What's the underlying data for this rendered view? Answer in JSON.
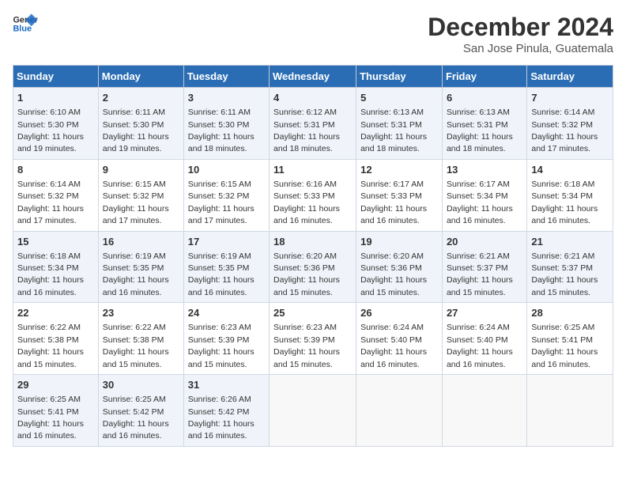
{
  "logo": {
    "line1": "General",
    "line2": "Blue"
  },
  "title": "December 2024",
  "subtitle": "San Jose Pinula, Guatemala",
  "weekdays": [
    "Sunday",
    "Monday",
    "Tuesday",
    "Wednesday",
    "Thursday",
    "Friday",
    "Saturday"
  ],
  "weeks": [
    [
      {
        "day": "1",
        "sunrise": "Sunrise: 6:10 AM",
        "sunset": "Sunset: 5:30 PM",
        "daylight": "Daylight: 11 hours and 19 minutes."
      },
      {
        "day": "2",
        "sunrise": "Sunrise: 6:11 AM",
        "sunset": "Sunset: 5:30 PM",
        "daylight": "Daylight: 11 hours and 19 minutes."
      },
      {
        "day": "3",
        "sunrise": "Sunrise: 6:11 AM",
        "sunset": "Sunset: 5:30 PM",
        "daylight": "Daylight: 11 hours and 18 minutes."
      },
      {
        "day": "4",
        "sunrise": "Sunrise: 6:12 AM",
        "sunset": "Sunset: 5:31 PM",
        "daylight": "Daylight: 11 hours and 18 minutes."
      },
      {
        "day": "5",
        "sunrise": "Sunrise: 6:13 AM",
        "sunset": "Sunset: 5:31 PM",
        "daylight": "Daylight: 11 hours and 18 minutes."
      },
      {
        "day": "6",
        "sunrise": "Sunrise: 6:13 AM",
        "sunset": "Sunset: 5:31 PM",
        "daylight": "Daylight: 11 hours and 18 minutes."
      },
      {
        "day": "7",
        "sunrise": "Sunrise: 6:14 AM",
        "sunset": "Sunset: 5:32 PM",
        "daylight": "Daylight: 11 hours and 17 minutes."
      }
    ],
    [
      {
        "day": "8",
        "sunrise": "Sunrise: 6:14 AM",
        "sunset": "Sunset: 5:32 PM",
        "daylight": "Daylight: 11 hours and 17 minutes."
      },
      {
        "day": "9",
        "sunrise": "Sunrise: 6:15 AM",
        "sunset": "Sunset: 5:32 PM",
        "daylight": "Daylight: 11 hours and 17 minutes."
      },
      {
        "day": "10",
        "sunrise": "Sunrise: 6:15 AM",
        "sunset": "Sunset: 5:32 PM",
        "daylight": "Daylight: 11 hours and 17 minutes."
      },
      {
        "day": "11",
        "sunrise": "Sunrise: 6:16 AM",
        "sunset": "Sunset: 5:33 PM",
        "daylight": "Daylight: 11 hours and 16 minutes."
      },
      {
        "day": "12",
        "sunrise": "Sunrise: 6:17 AM",
        "sunset": "Sunset: 5:33 PM",
        "daylight": "Daylight: 11 hours and 16 minutes."
      },
      {
        "day": "13",
        "sunrise": "Sunrise: 6:17 AM",
        "sunset": "Sunset: 5:34 PM",
        "daylight": "Daylight: 11 hours and 16 minutes."
      },
      {
        "day": "14",
        "sunrise": "Sunrise: 6:18 AM",
        "sunset": "Sunset: 5:34 PM",
        "daylight": "Daylight: 11 hours and 16 minutes."
      }
    ],
    [
      {
        "day": "15",
        "sunrise": "Sunrise: 6:18 AM",
        "sunset": "Sunset: 5:34 PM",
        "daylight": "Daylight: 11 hours and 16 minutes."
      },
      {
        "day": "16",
        "sunrise": "Sunrise: 6:19 AM",
        "sunset": "Sunset: 5:35 PM",
        "daylight": "Daylight: 11 hours and 16 minutes."
      },
      {
        "day": "17",
        "sunrise": "Sunrise: 6:19 AM",
        "sunset": "Sunset: 5:35 PM",
        "daylight": "Daylight: 11 hours and 16 minutes."
      },
      {
        "day": "18",
        "sunrise": "Sunrise: 6:20 AM",
        "sunset": "Sunset: 5:36 PM",
        "daylight": "Daylight: 11 hours and 15 minutes."
      },
      {
        "day": "19",
        "sunrise": "Sunrise: 6:20 AM",
        "sunset": "Sunset: 5:36 PM",
        "daylight": "Daylight: 11 hours and 15 minutes."
      },
      {
        "day": "20",
        "sunrise": "Sunrise: 6:21 AM",
        "sunset": "Sunset: 5:37 PM",
        "daylight": "Daylight: 11 hours and 15 minutes."
      },
      {
        "day": "21",
        "sunrise": "Sunrise: 6:21 AM",
        "sunset": "Sunset: 5:37 PM",
        "daylight": "Daylight: 11 hours and 15 minutes."
      }
    ],
    [
      {
        "day": "22",
        "sunrise": "Sunrise: 6:22 AM",
        "sunset": "Sunset: 5:38 PM",
        "daylight": "Daylight: 11 hours and 15 minutes."
      },
      {
        "day": "23",
        "sunrise": "Sunrise: 6:22 AM",
        "sunset": "Sunset: 5:38 PM",
        "daylight": "Daylight: 11 hours and 15 minutes."
      },
      {
        "day": "24",
        "sunrise": "Sunrise: 6:23 AM",
        "sunset": "Sunset: 5:39 PM",
        "daylight": "Daylight: 11 hours and 15 minutes."
      },
      {
        "day": "25",
        "sunrise": "Sunrise: 6:23 AM",
        "sunset": "Sunset: 5:39 PM",
        "daylight": "Daylight: 11 hours and 15 minutes."
      },
      {
        "day": "26",
        "sunrise": "Sunrise: 6:24 AM",
        "sunset": "Sunset: 5:40 PM",
        "daylight": "Daylight: 11 hours and 16 minutes."
      },
      {
        "day": "27",
        "sunrise": "Sunrise: 6:24 AM",
        "sunset": "Sunset: 5:40 PM",
        "daylight": "Daylight: 11 hours and 16 minutes."
      },
      {
        "day": "28",
        "sunrise": "Sunrise: 6:25 AM",
        "sunset": "Sunset: 5:41 PM",
        "daylight": "Daylight: 11 hours and 16 minutes."
      }
    ],
    [
      {
        "day": "29",
        "sunrise": "Sunrise: 6:25 AM",
        "sunset": "Sunset: 5:41 PM",
        "daylight": "Daylight: 11 hours and 16 minutes."
      },
      {
        "day": "30",
        "sunrise": "Sunrise: 6:25 AM",
        "sunset": "Sunset: 5:42 PM",
        "daylight": "Daylight: 11 hours and 16 minutes."
      },
      {
        "day": "31",
        "sunrise": "Sunrise: 6:26 AM",
        "sunset": "Sunset: 5:42 PM",
        "daylight": "Daylight: 11 hours and 16 minutes."
      },
      null,
      null,
      null,
      null
    ]
  ]
}
